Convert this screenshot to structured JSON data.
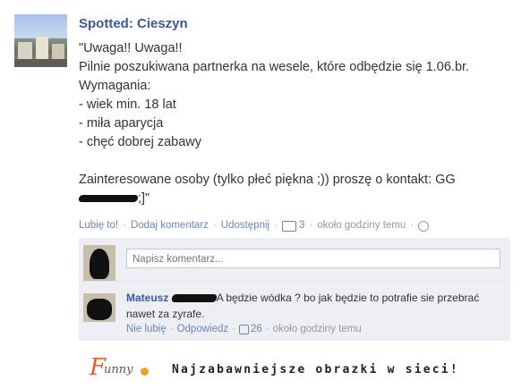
{
  "post": {
    "page_name": "Spotted: Cieszyn",
    "lines": [
      "\"Uwaga!! Uwaga!!",
      "Pilnie poszukiwana partnerka na wesele, które odbędzie się 1.06.br.",
      "Wymagania:",
      "- wiek min. 18 lat",
      "- miła aparycja",
      "- chęć dobrej zabawy",
      "",
      "Zainteresowane osoby (tylko płeć piękna ;)) proszę o kontakt: GG"
    ],
    "last_line_suffix": ";]\""
  },
  "actions": {
    "like": "Lubię to!",
    "comment": "Dodaj komentarz",
    "share": "Udostępnij",
    "comment_count": "3",
    "time": "około godziny temu"
  },
  "comment_input": {
    "placeholder": "Napisz komentarz..."
  },
  "comment": {
    "author": "Mateusz",
    "text": "A będzie wódka ? bo jak będzie to potrafie sie przebrać nawet za zyrafe.",
    "unlike": "Nie lubię",
    "reply": "Odpowiedz",
    "likes": "26",
    "time": "około godziny temu"
  },
  "footer": {
    "logo_big": "F",
    "logo_rest": "unny",
    "tagline": "Najzabawniejsze obrazki w sieci!"
  }
}
